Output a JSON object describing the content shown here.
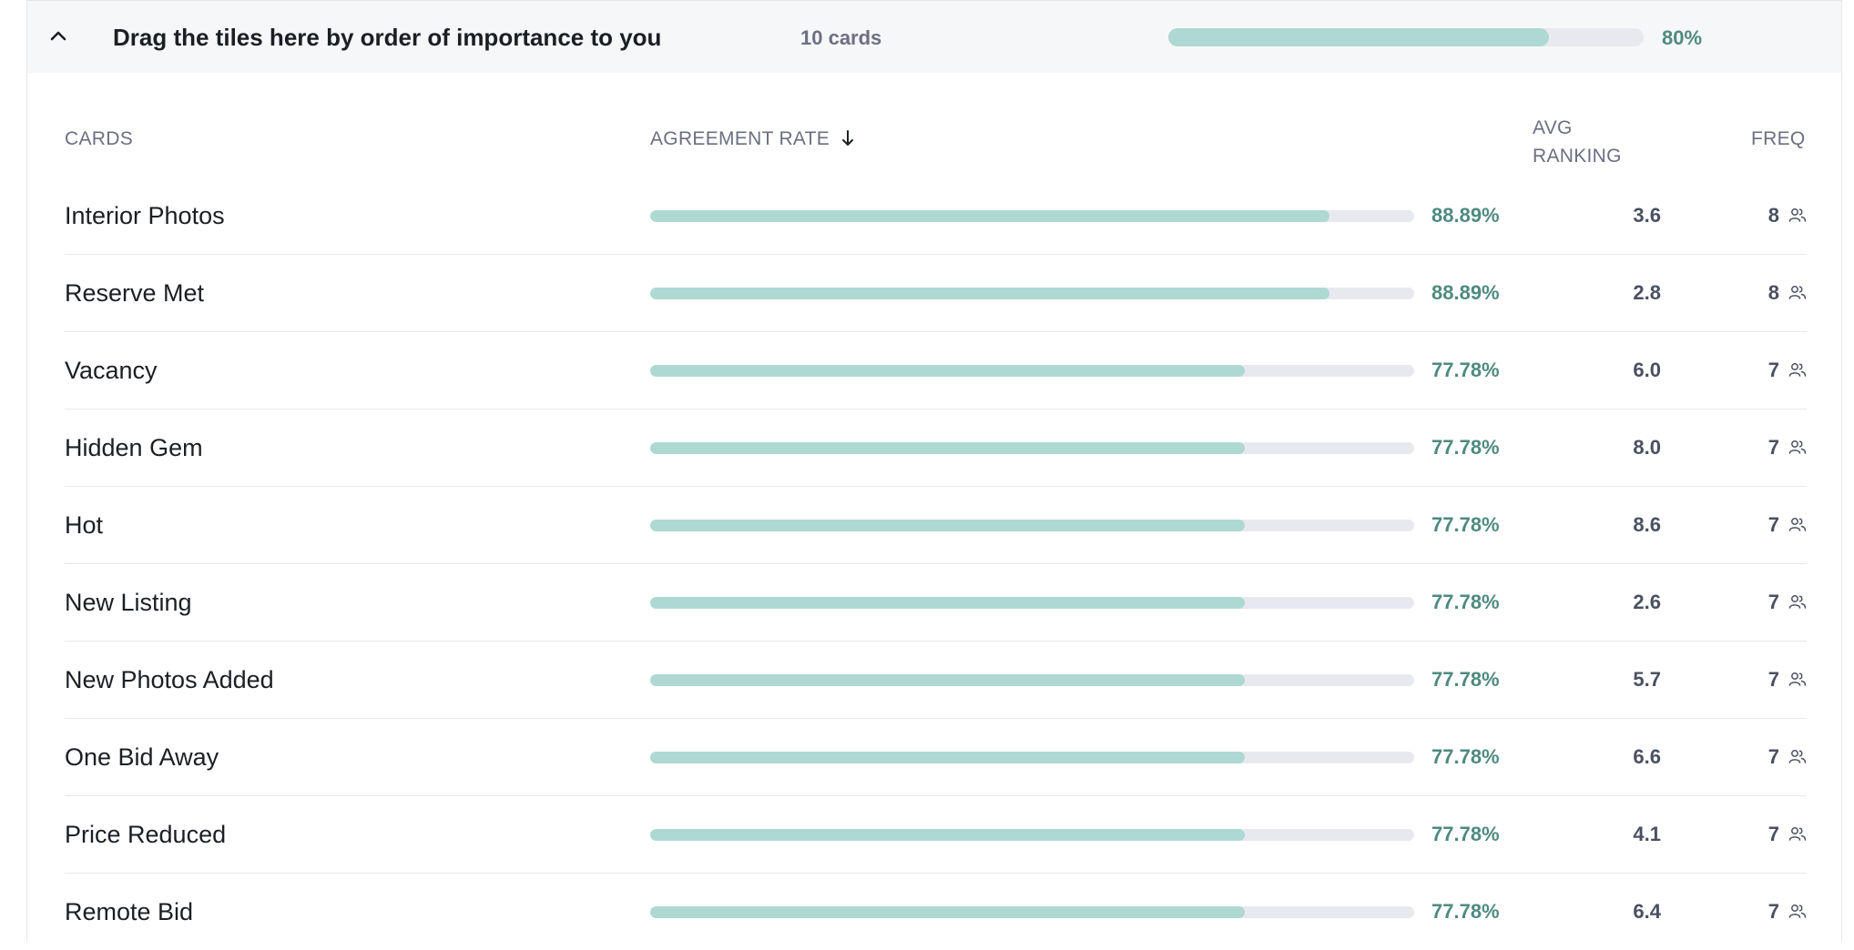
{
  "header": {
    "title": "Drag the tiles here by order of importance to you",
    "count": "10 cards",
    "progress": 0.8,
    "progress_label": "80%"
  },
  "columns": {
    "cards": "CARDS",
    "agreement": "AGREEMENT RATE",
    "avg_line1": "AVG",
    "avg_line2": "RANKING",
    "freq": "FREQ"
  },
  "rows": [
    {
      "name": "Interior Photos",
      "rate": 88.89,
      "rate_label": "88.89%",
      "avg": "3.6",
      "freq": "8"
    },
    {
      "name": "Reserve Met",
      "rate": 88.89,
      "rate_label": "88.89%",
      "avg": "2.8",
      "freq": "8"
    },
    {
      "name": "Vacancy",
      "rate": 77.78,
      "rate_label": "77.78%",
      "avg": "6.0",
      "freq": "7"
    },
    {
      "name": "Hidden Gem",
      "rate": 77.78,
      "rate_label": "77.78%",
      "avg": "8.0",
      "freq": "7"
    },
    {
      "name": "Hot",
      "rate": 77.78,
      "rate_label": "77.78%",
      "avg": "8.6",
      "freq": "7"
    },
    {
      "name": "New Listing",
      "rate": 77.78,
      "rate_label": "77.78%",
      "avg": "2.6",
      "freq": "7"
    },
    {
      "name": "New Photos Added",
      "rate": 77.78,
      "rate_label": "77.78%",
      "avg": "5.7",
      "freq": "7"
    },
    {
      "name": "One Bid Away",
      "rate": 77.78,
      "rate_label": "77.78%",
      "avg": "6.6",
      "freq": "7"
    },
    {
      "name": "Price Reduced",
      "rate": 77.78,
      "rate_label": "77.78%",
      "avg": "4.1",
      "freq": "7"
    },
    {
      "name": "Remote Bid",
      "rate": 77.78,
      "rate_label": "77.78%",
      "avg": "6.4",
      "freq": "7"
    }
  ],
  "colors": {
    "bar_fill": "#aed9d3",
    "bar_track": "#e8e9ef",
    "rate_text": "#4e8a7f"
  },
  "icons": {
    "collapse": "chevron-up-icon",
    "sort": "arrow-down-icon",
    "freq": "users-icon"
  }
}
